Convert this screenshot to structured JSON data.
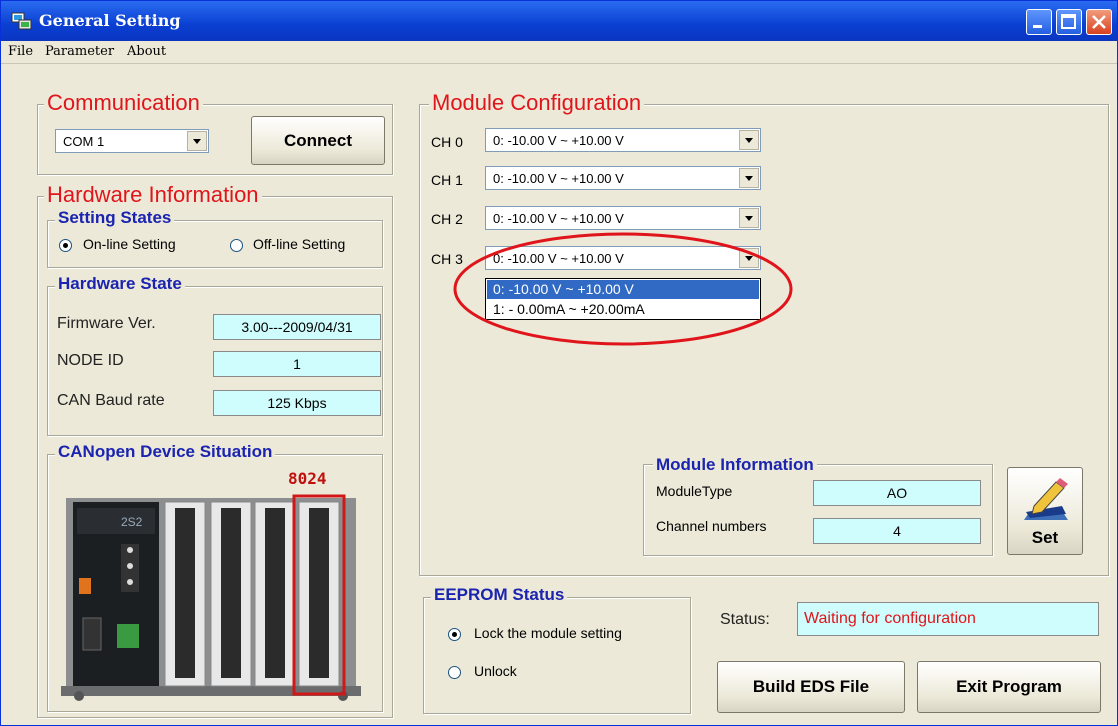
{
  "window": {
    "title": "General Setting"
  },
  "menu": [
    "File",
    "Parameter",
    "About"
  ],
  "communication": {
    "title": "Communication",
    "port": "COM 1",
    "connect_label": "Connect"
  },
  "hardware": {
    "title": "Hardware Information",
    "setting_states": {
      "title": "Setting States",
      "online": "On-line Setting",
      "offline": "Off-line Setting",
      "selected": "online"
    },
    "state": {
      "title": "Hardware State",
      "firmware_label": "Firmware Ver.",
      "firmware_value": "3.00---2009/04/31",
      "node_label": "NODE ID",
      "node_value": "1",
      "baud_label": "CAN Baud rate",
      "baud_value": "125  Kbps"
    },
    "device": {
      "title": "CANopen Device Situation",
      "module_label": "8024"
    }
  },
  "module_config": {
    "title": "Module Configuration",
    "channels": [
      {
        "label": "CH 0",
        "value": "0: -10.00  V  ~  +10.00  V"
      },
      {
        "label": "CH 1",
        "value": "0: -10.00  V  ~  +10.00  V"
      },
      {
        "label": "CH 2",
        "value": "0: -10.00  V  ~  +10.00  V"
      },
      {
        "label": "CH 3",
        "value": "0: -10.00  V  ~  +10.00  V"
      }
    ],
    "dropdown_options": [
      "0: -10.00  V  ~  +10.00  V",
      "1: -  0.00mA  ~  +20.00mA"
    ],
    "highlight_color": "#e0151b"
  },
  "module_info": {
    "title": "Module Information",
    "type_label": "ModuleType",
    "type_value": "AO",
    "channels_label": "Channel numbers",
    "channels_value": "4",
    "set_label": "Set"
  },
  "eeprom": {
    "title": "EEPROM Status",
    "lock": "Lock the module setting",
    "unlock": "Unlock",
    "selected": "lock"
  },
  "status": {
    "label": "Status:",
    "value": "Waiting for configuration",
    "value_color": "#e0151b"
  },
  "buttons": {
    "build_eds": "Build EDS File",
    "exit": "Exit Program"
  }
}
